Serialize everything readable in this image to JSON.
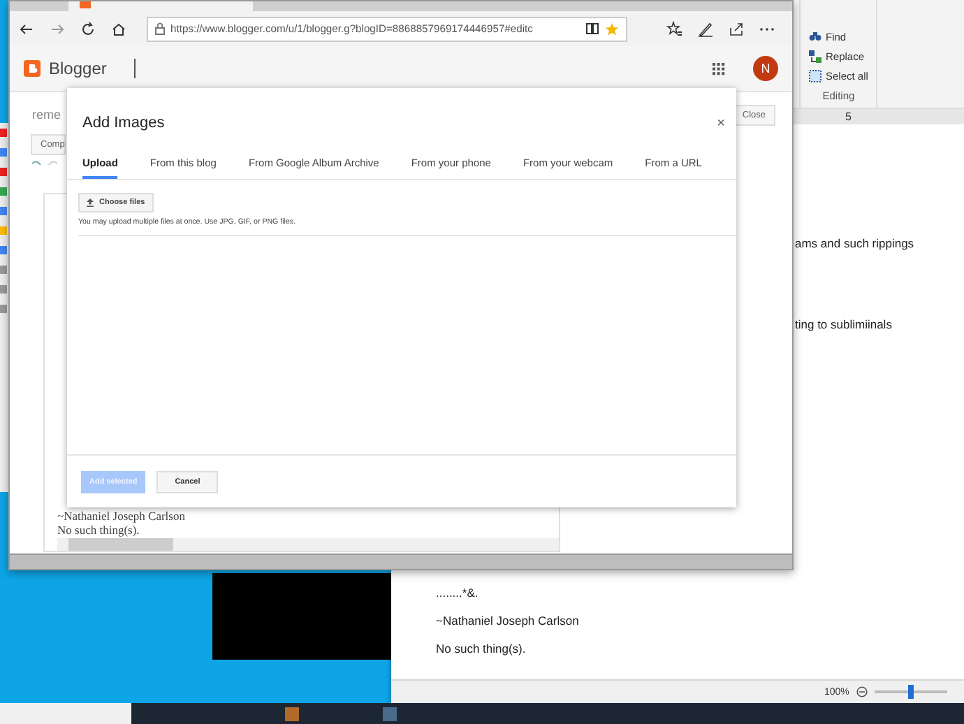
{
  "browser": {
    "url": "https://www.blogger.com/u/1/blogger.g?blogID=8868857969174446957#editc",
    "brand": "Blogger",
    "avatar": "N",
    "post_title": "reme",
    "compose_button": "Comp",
    "close_button": "Close",
    "editor_lines": [
      "~Nathaniel Joseph Carlson",
      "No such thing(s)."
    ]
  },
  "dialog": {
    "title": "Add Images",
    "close": "×",
    "tabs": [
      {
        "label": "Upload",
        "selected": true
      },
      {
        "label": "From this blog",
        "selected": false
      },
      {
        "label": "From Google Album Archive",
        "selected": false
      },
      {
        "label": "From your phone",
        "selected": false
      },
      {
        "label": "From your webcam",
        "selected": false
      },
      {
        "label": "From a URL",
        "selected": false
      }
    ],
    "choose_button": "Choose files",
    "hint": "You may upload multiple files at once. Use JPG, GIF, or PNG files.",
    "buttons": [
      {
        "label": "Add selected",
        "disabled": true
      },
      {
        "label": "Cancel",
        "disabled": false
      }
    ]
  },
  "word": {
    "editing": [
      {
        "kind": "find",
        "label": "Find"
      },
      {
        "kind": "replace",
        "label": "Replace"
      },
      {
        "kind": "select",
        "label": "Select all"
      }
    ],
    "group_label": "Editing",
    "ruler_mark": "5",
    "fragments": [
      "ams and such rippings",
      "ting to sublimiinals"
    ],
    "lines": [
      "........*&.",
      "~Nathaniel Joseph Carlson",
      "No such thing(s)."
    ],
    "zoom": "100%",
    "zoom_slider": {
      "level": 0.5
    }
  }
}
